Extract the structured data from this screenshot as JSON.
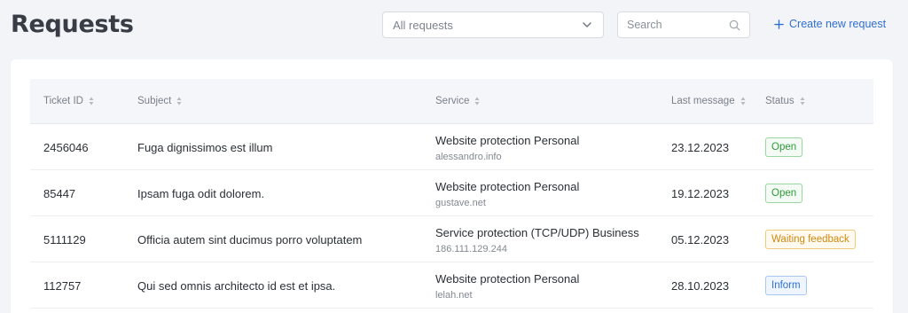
{
  "page": {
    "title": "Requests"
  },
  "filter": {
    "selected": "All requests",
    "icon": "chevron-down-icon"
  },
  "search": {
    "placeholder": "Search",
    "value": "",
    "icon": "search-icon"
  },
  "create_button": {
    "label": "Create new request",
    "icon": "plus-icon"
  },
  "table": {
    "headers": {
      "ticket_id": "Ticket ID",
      "subject": "Subject",
      "service": "Service",
      "last_message": "Last message",
      "status": "Status"
    },
    "rows": [
      {
        "ticket_id": "2456046",
        "subject": "Fuga dignissimos est illum",
        "service": "Website protection Personal",
        "host": "alessandro.info",
        "last_message": "23.12.2023",
        "status": "Open"
      },
      {
        "ticket_id": "85447",
        "subject": "Ipsam fuga odit dolorem.",
        "service": "Website protection Personal",
        "host": "gustave.net",
        "last_message": "19.12.2023",
        "status": "Open"
      },
      {
        "ticket_id": "5111129",
        "subject": "Officia autem sint ducimus porro voluptatem",
        "service": "Service protection (TCP/UDP) Business",
        "host": "186.111.129.244",
        "last_message": "05.12.2023",
        "status": "Waiting feedback"
      },
      {
        "ticket_id": "112757",
        "subject": "Qui sed omnis architecto id est et ipsa.",
        "service": "Website protection Personal",
        "host": "lelah.net",
        "last_message": "28.10.2023",
        "status": "Inform"
      }
    ]
  },
  "status_colors": {
    "Open": {
      "text": "#2e9a3a",
      "border": "#9ad7a1",
      "bg": "#f3fbf4"
    },
    "Waiting feedback": {
      "text": "#d0890f",
      "border": "#f0c97a",
      "bg": "#fffaf0"
    },
    "Inform": {
      "text": "#2f6fd0",
      "border": "#a9c8f0",
      "bg": "#eef5fe"
    }
  }
}
